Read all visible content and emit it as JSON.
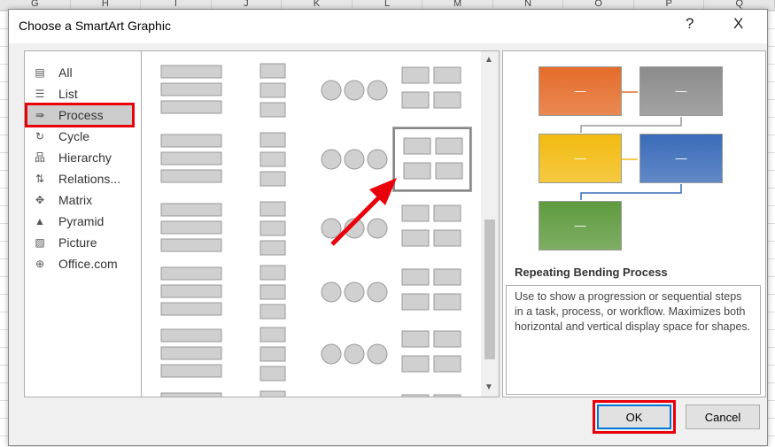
{
  "sheet": {
    "columns": [
      "G",
      "H",
      "I",
      "J",
      "K",
      "L",
      "M",
      "N",
      "O",
      "P",
      "Q"
    ]
  },
  "dialog": {
    "title": "Choose a SmartArt Graphic",
    "help_label": "?",
    "close_label": "X",
    "categories": [
      {
        "label": "All",
        "icon": "all-icon"
      },
      {
        "label": "List",
        "icon": "list-icon"
      },
      {
        "label": "Process",
        "icon": "process-icon",
        "selected": true
      },
      {
        "label": "Cycle",
        "icon": "cycle-icon"
      },
      {
        "label": "Hierarchy",
        "icon": "hierarchy-icon"
      },
      {
        "label": "Relations...",
        "icon": "relationship-icon"
      },
      {
        "label": "Matrix",
        "icon": "matrix-icon"
      },
      {
        "label": "Pyramid",
        "icon": "pyramid-icon"
      },
      {
        "label": "Picture",
        "icon": "picture-icon"
      },
      {
        "label": "Office.com",
        "icon": "globe-icon"
      }
    ],
    "preview": {
      "name": "Repeating Bending Process",
      "description": "Use to show a progression or sequential steps in a task, process, or workflow. Maximizes both horizontal and vertical display space for shapes.",
      "shape_text": "—",
      "colors": [
        "#e46c2a",
        "#8c8c8c",
        "#f2bb12",
        "#3a6bb8",
        "#5e9a3e"
      ]
    },
    "ok_label": "OK",
    "cancel_label": "Cancel",
    "accent": "#e8000b"
  }
}
